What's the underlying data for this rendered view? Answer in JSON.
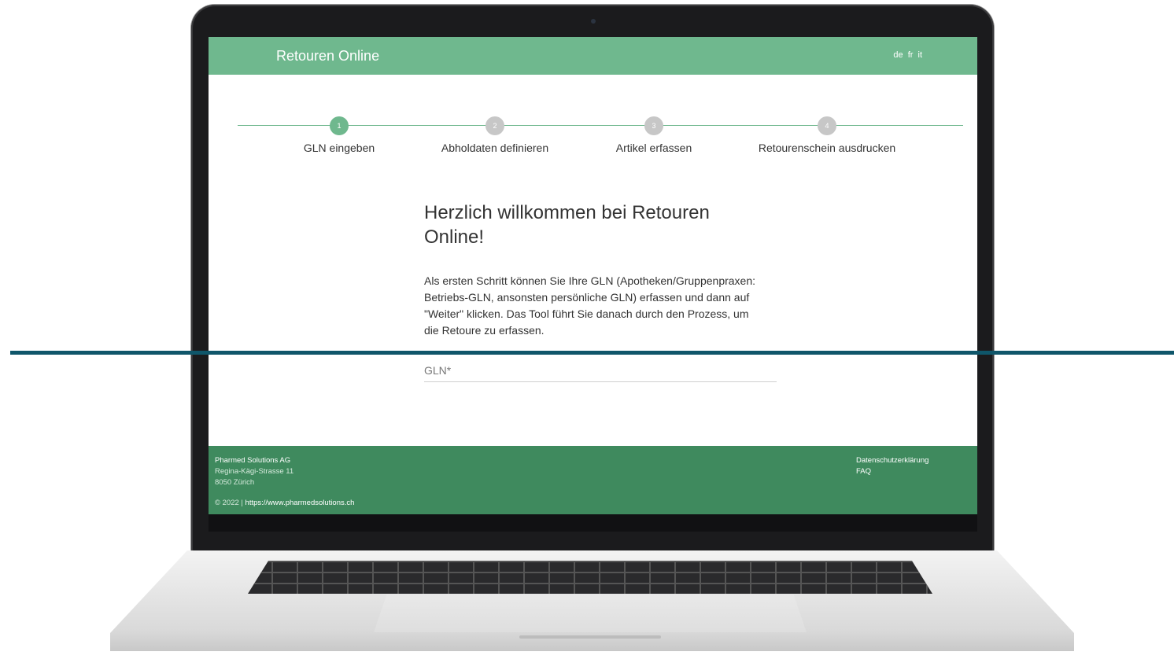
{
  "header": {
    "title": "Retouren Online",
    "languages": [
      "de",
      "fr",
      "it"
    ]
  },
  "steps": [
    {
      "number": "1",
      "label": "GLN eingeben",
      "active": true
    },
    {
      "number": "2",
      "label": "Abholdaten definieren",
      "active": false
    },
    {
      "number": "3",
      "label": "Artikel erfassen",
      "active": false
    },
    {
      "number": "4",
      "label": "Retourenschein ausdrucken",
      "active": false
    }
  ],
  "main": {
    "heading_line1": "Herzlich willkommen bei Retouren",
    "heading_line2": "Online!",
    "intro": "Als ersten Schritt können Sie Ihre GLN (Apotheken/Gruppenpraxen: Betriebs-GLN, ansonsten persönliche GLN) erfassen und dann auf \"Weiter\" klicken. Das Tool führt Sie danach durch den Prozess, um die Retoure zu erfassen.",
    "gln": {
      "placeholder": "GLN*",
      "value": ""
    }
  },
  "footer": {
    "company": "Pharmed Solutions AG",
    "street": "Regina-Kägi-Strasse 11",
    "city": "8050 Zürich",
    "copyright": "© 2022 |",
    "url": "https://www.pharmedsolutions.ch",
    "links": [
      "Datenschutzerklärung",
      "FAQ"
    ]
  },
  "colors": {
    "header_green": "#6fb88e",
    "footer_green": "#3f8a5e",
    "accent_line": "#0f566a"
  }
}
